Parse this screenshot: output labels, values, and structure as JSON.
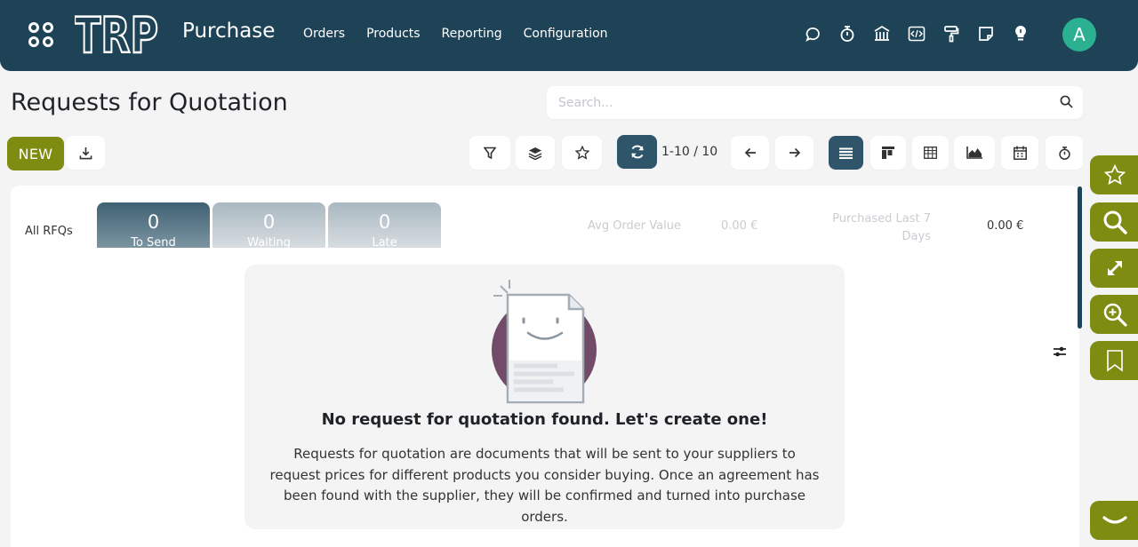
{
  "navbar": {
    "app_name": "Purchase",
    "logo_text": "TRP",
    "menu": [
      "Orders",
      "Products",
      "Reporting",
      "Configuration"
    ],
    "system_icons": [
      "chat-icon",
      "timer-icon",
      "bank-icon",
      "code-icon",
      "paint-roller-icon",
      "note-icon",
      "lightbulb-icon"
    ],
    "avatar_letter": "A",
    "avatar_color": "#2bb092",
    "bar_color": "#1e4357"
  },
  "control_panel": {
    "title": "Requests for Quotation",
    "search_placeholder": "Search...",
    "new_label": "NEW",
    "pager": "1-10 / 10",
    "accent_color": "#7f8c12"
  },
  "dashboard": {
    "all_label": "All RFQs",
    "tiles": [
      {
        "value": "0",
        "label": "To Send"
      },
      {
        "value": "0",
        "label": "Waiting"
      },
      {
        "value": "0",
        "label": "Late"
      }
    ],
    "avg_order_label": "Avg Order Value",
    "avg_order_value": "0.00 €",
    "purchased_label_1": "Purchased Last 7",
    "purchased_label_2": "Days",
    "purchased_value": "0.00 €"
  },
  "empty_state": {
    "title": "No request for quotation found. Let's create one!",
    "text": "Requests for quotation are documents that will be sent to your suppliers to request prices for different products you consider buying. Once an agreement has been found with the supplier, they will be confirmed and turned into purchase orders."
  },
  "side_buttons": [
    "star-icon",
    "search-icon",
    "expand-icon",
    "zoom-in-icon",
    "bookmark-icon",
    "chevron-down-icon"
  ]
}
